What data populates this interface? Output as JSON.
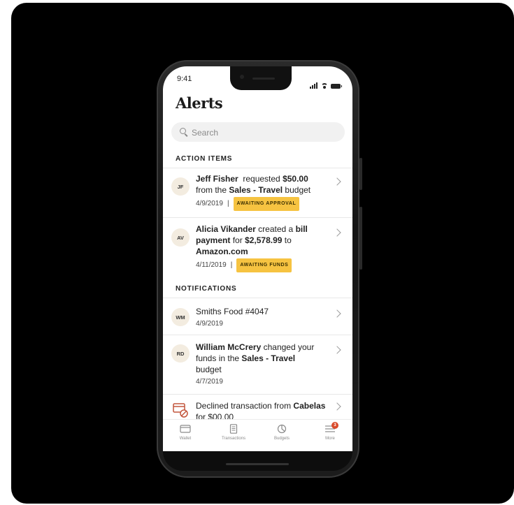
{
  "status_bar": {
    "time": "9:41"
  },
  "title": "Alerts",
  "search": {
    "placeholder": "Search"
  },
  "sections": {
    "action_items": "ACTION ITEMS",
    "notifications": "NOTIFICATIONS"
  },
  "action_items": [
    {
      "initials": "JF",
      "name": "Jeff Fisher",
      "verb": "requested",
      "amount": "$50.00",
      "text_mid": "from the",
      "budget": "Sales - Travel",
      "text_end": "budget",
      "date": "4/9/2019",
      "status": "AWAITING APPROVAL"
    },
    {
      "initials": "AV",
      "name": "Alicia Vikander",
      "verb": "created a",
      "object": "bill payment",
      "text_for": "for",
      "amount": "$2,578.99",
      "text_to": "to",
      "payee": "Amazon.com",
      "date": "4/11/2019",
      "status": "AWAITING FUNDS"
    }
  ],
  "notifications": [
    {
      "initials": "WM",
      "text": "Smiths Food #4047",
      "date": "4/9/2019"
    },
    {
      "initials": "RD",
      "name": "William McCrery",
      "verb": "changed your funds in the",
      "budget": "Sales - Travel",
      "text_end": "budget",
      "date": "4/7/2019"
    },
    {
      "text": "Declined transaction from",
      "merchant": "Cabelas",
      "partial": "for $00.00"
    }
  ],
  "tabbar": [
    {
      "label": "Wallet",
      "icon": "wallet-icon"
    },
    {
      "label": "Transactions",
      "icon": "receipt-icon"
    },
    {
      "label": "Budgets",
      "icon": "budget-icon"
    },
    {
      "label": "More",
      "icon": "menu-icon",
      "badge": "3"
    }
  ],
  "colors": {
    "pill": "#f6c341",
    "badge": "#d94b2b",
    "avatar_bg": "#f3ece0",
    "decline_icon": "#c2553c"
  }
}
